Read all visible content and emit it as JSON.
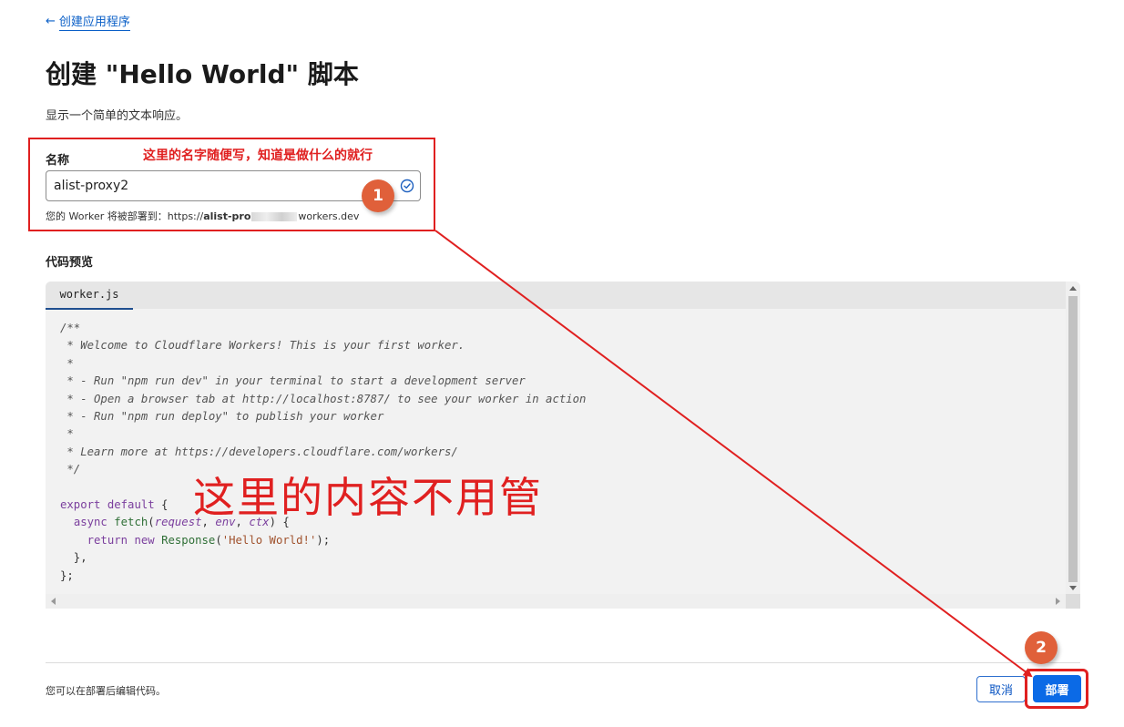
{
  "nav": {
    "back_arrow": "←",
    "back_label": "创建应用程序",
    "back_icon": "arrow-left-icon"
  },
  "page": {
    "title": "创建 \"Hello World\" 脚本",
    "subtitle": "显示一个简单的文本响应。"
  },
  "name_field": {
    "label": "名称",
    "value": "alist-proxy2",
    "deploy_prefix": "您的 Worker 将被部署到：https://",
    "deploy_bold": "alist-pro",
    "deploy_suffix": "workers.dev"
  },
  "code_preview": {
    "label": "代码预览",
    "tab": "worker.js",
    "comment_lines": [
      "/**",
      " * Welcome to Cloudflare Workers! This is your first worker.",
      " *",
      " * - Run \"npm run dev\" in your terminal to start a development server",
      " * - Open a browser tab at http://localhost:8787/ to see your worker in action",
      " * - Run \"npm run deploy\" to publish your worker",
      " *",
      " * Learn more at https://developers.cloudflare.com/workers/",
      " */"
    ],
    "code": {
      "kw_export": "export",
      "kw_default": "default",
      "brace_open": " {",
      "kw_async": "async",
      "fn_fetch": "fetch",
      "p_request": "request",
      "p_env": "env",
      "p_ctx": "ctx",
      "kw_return": "return",
      "kw_new": "new",
      "fn_response": "Response",
      "str_hello": "'Hello World!'",
      "line_close_method": "  },",
      "line_close_obj": "};"
    }
  },
  "footer": {
    "note": "您可以在部署后编辑代码。",
    "cancel_label": "取消",
    "deploy_label": "部署"
  },
  "annotations": {
    "name_hint": "这里的名字随便写，知道是做什么的就行",
    "content_hint": "这里的内容不用管",
    "badge_1": "1",
    "badge_2": "2",
    "color": "#e02020",
    "badge_color": "#e0603a"
  }
}
